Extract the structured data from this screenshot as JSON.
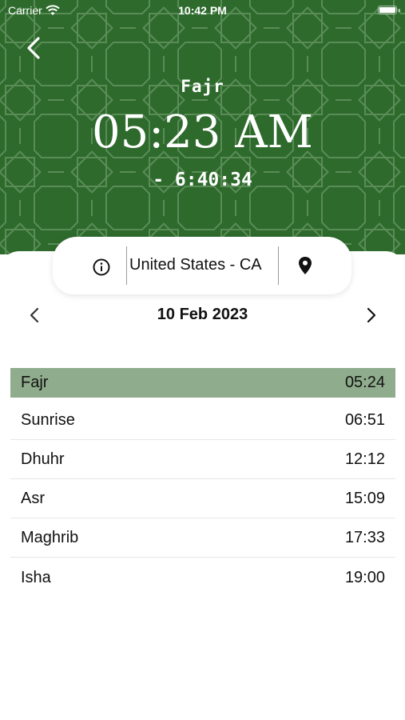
{
  "status_bar": {
    "carrier": "Carrier",
    "time": "10:42 PM"
  },
  "header": {
    "prayer_name": "Fajr",
    "prayer_time": "05:23 AM",
    "countdown": "- 6:40:34",
    "background_color": "#2d6a2c",
    "pattern_color": "#7fa77a"
  },
  "location": {
    "label": "United States - CA"
  },
  "date_nav": {
    "date": "10 Feb 2023"
  },
  "prayer_times": [
    {
      "name": "Fajr",
      "time": "05:24",
      "active": true
    },
    {
      "name": "Sunrise",
      "time": "06:51",
      "active": false
    },
    {
      "name": "Dhuhr",
      "time": "12:12",
      "active": false
    },
    {
      "name": "Asr",
      "time": "15:09",
      "active": false
    },
    {
      "name": "Maghrib",
      "time": "17:33",
      "active": false
    },
    {
      "name": "Isha",
      "time": "19:00",
      "active": false
    }
  ],
  "colors": {
    "active_row": "#8fac8c",
    "divider": "#e6e6e6"
  },
  "icons": {
    "back": "chevron-left-icon",
    "info": "info-circle-icon",
    "location": "map-pin-icon",
    "prev_date": "chevron-left-icon",
    "next_date": "chevron-right-icon"
  }
}
